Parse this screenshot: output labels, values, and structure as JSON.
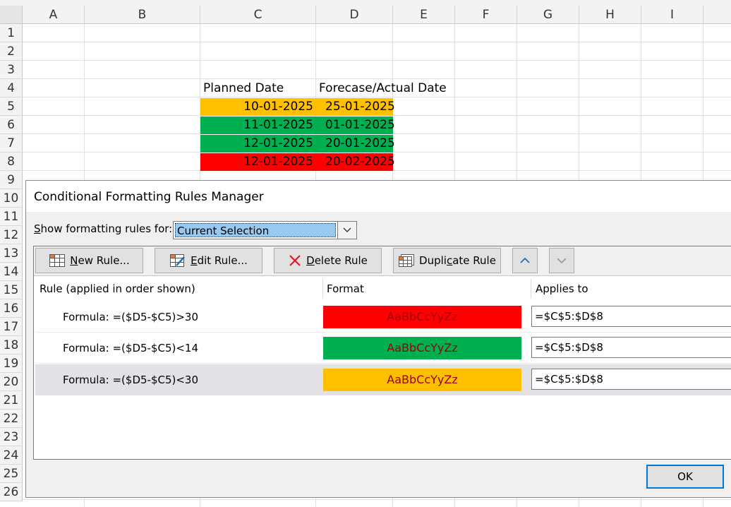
{
  "sheet": {
    "columns": [
      "A",
      "B",
      "C",
      "D",
      "E",
      "F",
      "G",
      "H",
      "I"
    ],
    "rows": [
      "1",
      "2",
      "3",
      "4",
      "5",
      "6",
      "7",
      "8",
      "9",
      "10",
      "11",
      "12",
      "13",
      "14",
      "15",
      "16",
      "17",
      "18",
      "19",
      "20",
      "21",
      "22",
      "23",
      "24",
      "25",
      "26"
    ],
    "headers": {
      "planned": "Planned Date",
      "forecast": "Forecase/Actual Date"
    },
    "data": [
      {
        "planned": "10-01-2025",
        "forecast": "25-01-2025",
        "fill": "#ffc000"
      },
      {
        "planned": "11-01-2025",
        "forecast": "01-01-2025",
        "fill": "#00b050"
      },
      {
        "planned": "12-01-2025",
        "forecast": "20-01-2025",
        "fill": "#00b050"
      },
      {
        "planned": "12-01-2025",
        "forecast": "20-02-2025",
        "fill": "#ff0000"
      }
    ]
  },
  "dialog": {
    "title": "Conditional Formatting Rules Manager",
    "show_label_prefix": "S",
    "show_label_rest": "how formatting rules for:",
    "scope_value": "Current Selection",
    "toolbar": {
      "new_rule": {
        "u": "N",
        "rest": "ew Rule..."
      },
      "edit_rule": {
        "u": "E",
        "rest": "dit Rule..."
      },
      "delete_rule": {
        "u": "D",
        "rest": "elete Rule"
      },
      "duplicate_rule": {
        "pre": "Dupli",
        "u": "c",
        "rest": "ate Rule"
      }
    },
    "columns": {
      "rule": "Rule (applied in order shown)",
      "format": "Format",
      "applies": "Applies to"
    },
    "rules": [
      {
        "formula": "Formula: =($D5-$C5)>30",
        "preview": "AaBbCcYyZz",
        "fill": "#ff0000",
        "applies": "=$C$5:$D$8"
      },
      {
        "formula": "Formula: =($D5-$C5)<14",
        "preview": "AaBbCcYyZz",
        "fill": "#00b050",
        "applies": "=$C$5:$D$8"
      },
      {
        "formula": "Formula: =($D5-$C5)<30",
        "preview": "AaBbCcYyZz",
        "fill": "#ffc000",
        "applies": "=$C$5:$D$8"
      }
    ],
    "ok_label": "OK"
  }
}
